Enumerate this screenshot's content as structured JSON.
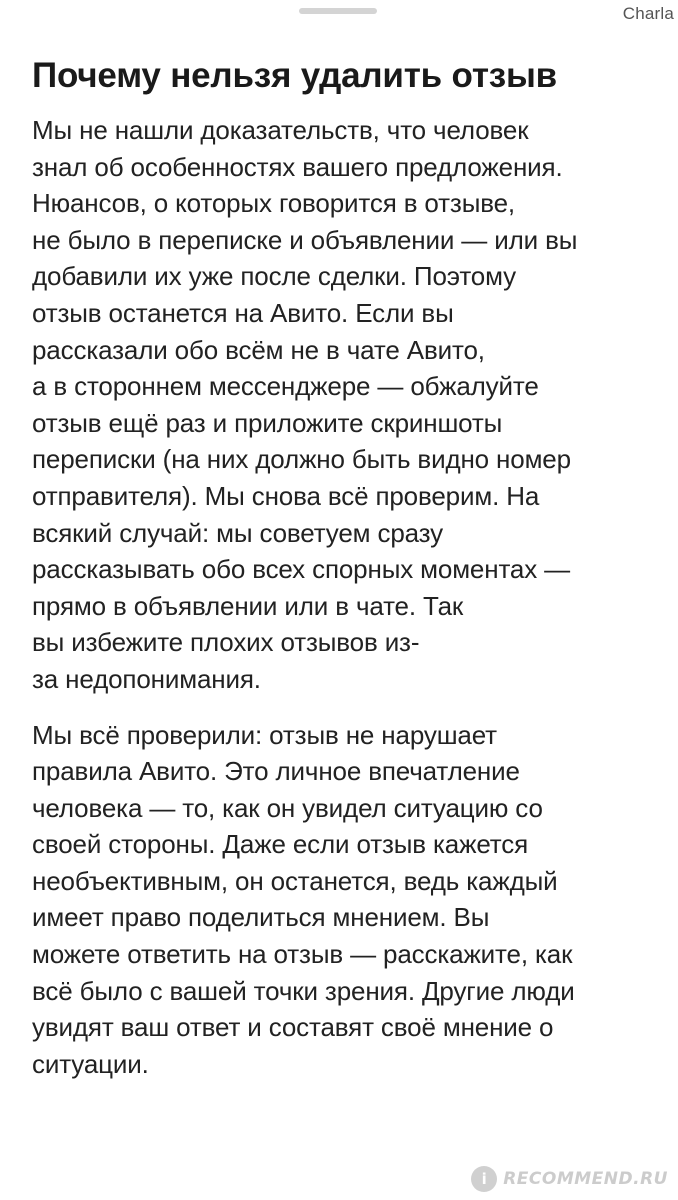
{
  "header": {
    "watermark": "Charla"
  },
  "article": {
    "title": "Почему нельзя удалить отзыв",
    "paragraphs": [
      "Мы не нашли доказательств, что человек\nзнал об особенностях вашего предложения.\nНюансов, о которых говорится в отзыве,\nне было в переписке и объявлении — или вы\nдобавили их уже после сделки. Поэтому\nотзыв останется на Авито. Если вы\nрассказали обо всём не в чате Авито,\nа в стороннем мессенджере — обжалуйте\nотзыв ещё раз и приложите скриншоты\nпереписки (на них должно быть видно номер\nотправителя). Мы снова всё проверим. На\nвсякий случай: мы советуем сразу\nрассказывать обо всех спорных моментах —\nпрямо в объявлении или в чате. Так\nвы избежите плохих отзывов из-\nза недопонимания.",
      "Мы всё проверили: отзыв не нарушает\nправила Авито. Это личное впечатление\nчеловека — то, как он увидел ситуацию со\nсвоей стороны. Даже если отзыв кажется\nнеобъективным, он останется, ведь каждый\nимеет право поделиться мнением. Вы\nможете ответить на отзыв — расскажите, как\nвсё было с вашей точки зрения. Другие люди\nувидят ваш ответ и составят своё мнение о\nситуации."
    ]
  },
  "footer": {
    "watermark_logo": "i",
    "watermark_text": "RECOMMEND.RU"
  }
}
